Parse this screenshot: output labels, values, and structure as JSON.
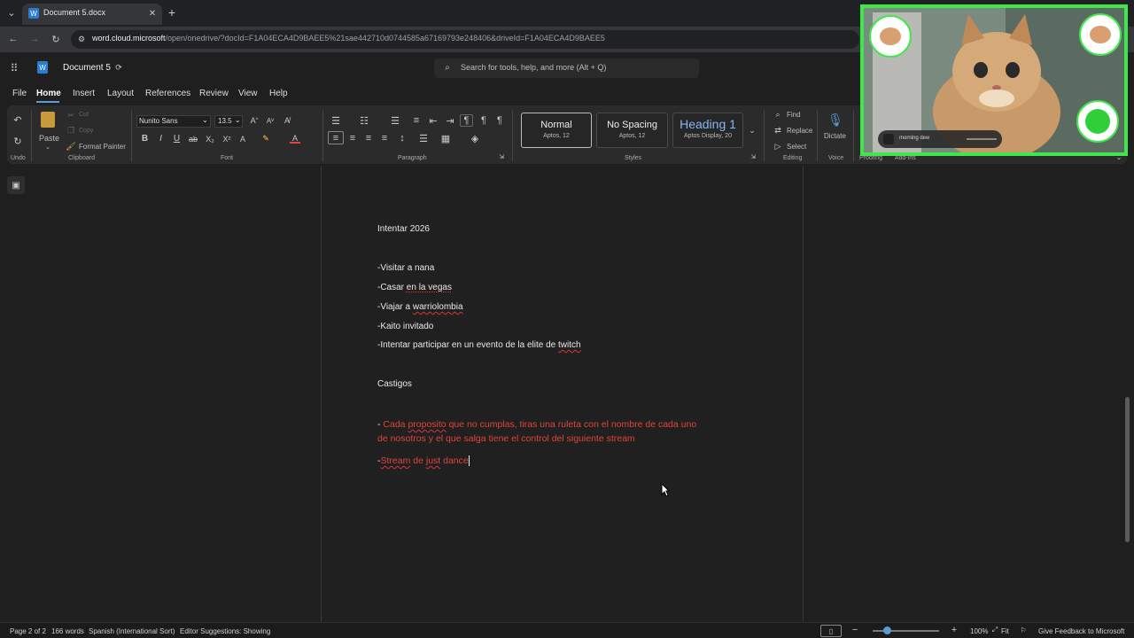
{
  "browser": {
    "tab_title": "Document 5.docx",
    "url_host": "word.cloud.microsoft",
    "url_path": "/open/onedrive/?docId=F1A04ECA4D9BAEE5%21sae442710d0744585a67169793e248406&driveId=F1A04ECA4D9BAEE5"
  },
  "office": {
    "doc_title": "Document 5",
    "search_placeholder": "Search for tools, help, and more (Alt + Q)"
  },
  "menu": [
    "File",
    "Home",
    "Insert",
    "Layout",
    "References",
    "Review",
    "View",
    "Help"
  ],
  "ribbon": {
    "undo_label": "Undo",
    "paste_label": "Paste",
    "cut_label": "Cut",
    "copy_label": "Copy",
    "format_painter_label": "Format Painter",
    "clipboard_group": "Clipboard",
    "font_name": "Nunito Sans",
    "font_size": "13.5",
    "font_group": "Font",
    "paragraph_group": "Paragraph",
    "styles_group": "Styles",
    "styles": [
      {
        "name": "Normal",
        "sub": "Aptos, 12"
      },
      {
        "name": "No Spacing",
        "sub": "Aptos, 12"
      },
      {
        "name": "Heading 1",
        "sub": "Aptos Display, 20"
      }
    ],
    "find_label": "Find",
    "replace_label": "Replace",
    "select_label": "Select",
    "editing_group": "Editing",
    "dictate_label": "Dictate",
    "voice_group": "Voice",
    "proofing_group": "Proofing",
    "addins_group": "Add-ins"
  },
  "document": {
    "heading1": "Intentar 2026",
    "items": {
      "i1_prefix": "-Visitar a nana",
      "i2_a": "-Casar ",
      "i2_b": "en la vegas",
      "i3_a": "-Viajar a ",
      "i3_b": "warriolombia",
      "i4": "-Kaito invitado",
      "i5_a": "-Intentar participar en un evento de la elite de ",
      "i5_b": "twitch"
    },
    "heading2": "Castigos",
    "p1_dash": "- ",
    "p1_a": "Cada ",
    "p1_b": "proposito",
    "p1_c": " que no cumplas, tiras una ruleta con el nombre de cada uno",
    "p1_line2": "de nosotros y el que salga tiene el control del siguiente stream",
    "p2_dash": "-",
    "p2_a": "Stream",
    "p2_b": " de ",
    "p2_c": "just",
    "p2_d": " dance"
  },
  "status": {
    "page": "Page 2 of 2",
    "words": "166 words",
    "language": "Spanish (International Sort)",
    "editor": "Editor Suggestions: Showing",
    "zoom": "100%",
    "fit": "Fit",
    "feedback": "Give Feedback to Microsoft"
  },
  "overlay": {
    "caption": "morning dew"
  },
  "colors": {
    "accent_green": "#3fe84a",
    "doc_red": "#e0443c"
  }
}
